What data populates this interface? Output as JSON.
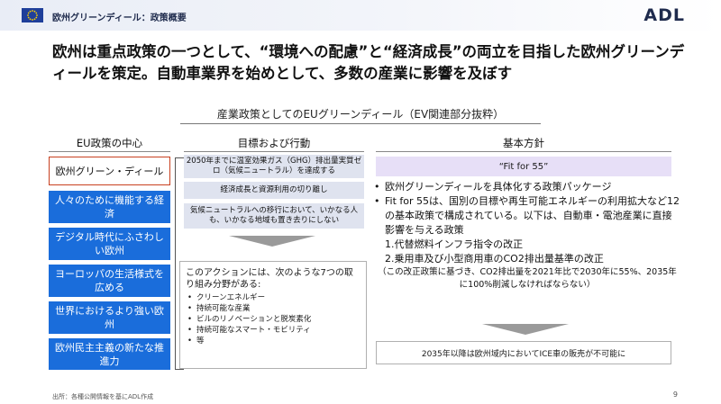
{
  "header": {
    "title": "欧州グリーンディール：政策概要",
    "logo": "ADL",
    "flag_icon": "eu-flag-icon"
  },
  "headline": "欧州は重点政策の一つとして、“環境への配慮”と“経済成長”の両立を目指した欧州グリーンディールを策定。自動車業界を始めとして、多数の産業に影響を及ぼす",
  "subtitle": "産業政策としてのEUグリーンディール（EV関連部分抜粋）",
  "columns": {
    "left": "EU政策の中心",
    "middle": "目標および行動",
    "right": "基本方針"
  },
  "left_items": [
    "欧州グリーン・ディール",
    "人々のために機能する経済",
    "デジタル時代にふさわしい欧州",
    "ヨーロッパの生活様式を広める",
    "世界におけるより強い欧州",
    "欧州民主主義の新たな推進力"
  ],
  "goals": [
    "2050年までに温室効果ガス（GHG）排出量実質ゼロ（気候ニュートラル）を達成する",
    "経済成長と資源利用の切り離し",
    "気候ニュートラルへの移行において、いかなる人も、いかなる地域も置き去りにしない"
  ],
  "actions": {
    "intro": "このアクションには、次のような7つの取り組み分野がある:",
    "items": [
      "クリーンエネルギー",
      "持続可能な産業",
      "ビルのリノベーションと脱炭素化",
      "持続可能なスマート・モビリティ",
      "等"
    ]
  },
  "policy": {
    "fit_label": "“Fit for 55”",
    "bullet1": "欧州グリーンディールを具体化する政策パッケージ",
    "bullet2": "Fit for 55は、国別の目標や再生可能エネルギーの利用拡大など12の基本政策で構成されている。以下は、自動車・電池産業に直接影響を与える政策",
    "item1": "1.代替燃料インフラ指令の改正",
    "item2": "2.乗用車及び小型商用車のCO2排出量基準の改正",
    "note": "（この改正政策に基づき、CO2排出量を2021年比で2030年に55%、2035年に100%削減しなければならない）",
    "result": "2035年以降は欧州域内においてICE車の販売が不可能に"
  },
  "footer": "出所：各種公開情報を基にADL作成",
  "page_number": "9",
  "colors": {
    "blue": "#1a6ddb",
    "highlight_border": "#c8401f",
    "goal_bg": "#dfe3ef",
    "fit_bg": "#e7dff7"
  }
}
